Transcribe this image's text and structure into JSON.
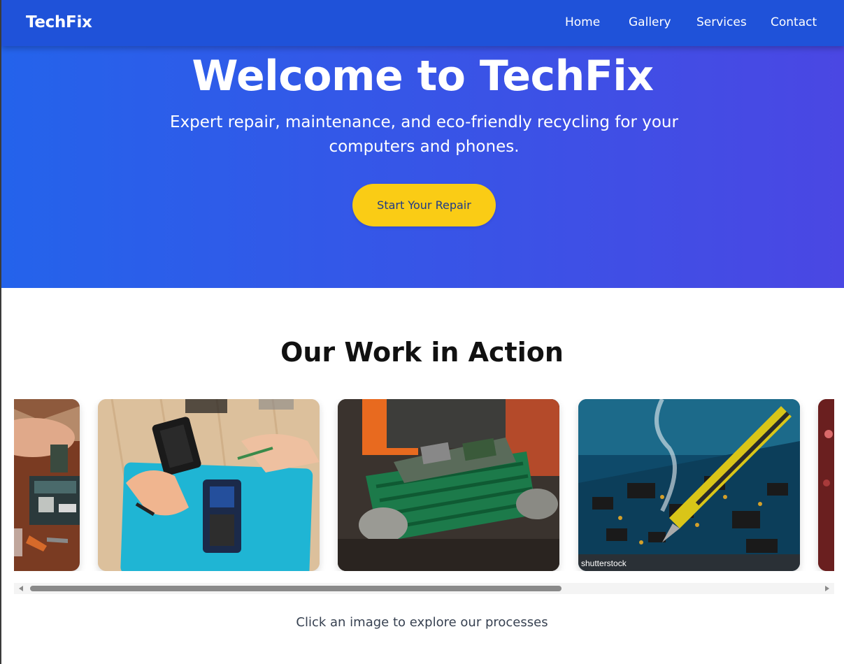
{
  "nav": {
    "brand": "TechFix",
    "links": [
      "Home",
      "Gallery",
      "Services",
      "Contact"
    ]
  },
  "hero": {
    "title": "Welcome to TechFix",
    "subtitle": "Expert repair, maintenance, and eco-friendly recycling for your computers and phones.",
    "cta_label": "Start Your Repair"
  },
  "gallery": {
    "title": "Our Work in Action",
    "caption": "Click an image to explore our processes",
    "images": [
      {
        "subject": "motherboard-tools"
      },
      {
        "subject": "phone-repair"
      },
      {
        "subject": "ewaste-recycling"
      },
      {
        "subject": "soldering-circuit-board",
        "watermark": "shutterstock"
      },
      {
        "subject": "partial-image"
      }
    ]
  },
  "colors": {
    "nav_bg": "#1f52d9",
    "hero_gradient_start": "#2463eb",
    "hero_gradient_end": "#4a47e3",
    "cta_bg": "#facc15",
    "cta_text": "#1e3a8a"
  }
}
